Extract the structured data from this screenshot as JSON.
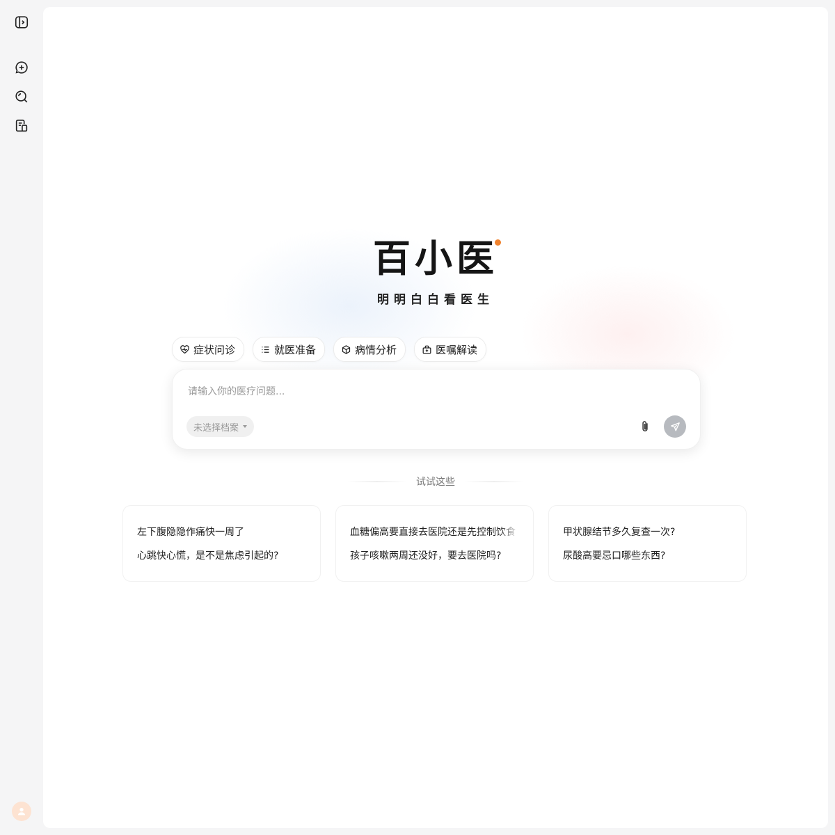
{
  "brand": {
    "logo": "百小医",
    "slogan": "明明白白看医生",
    "accent_color": "#f0822d"
  },
  "sidebar": {
    "items": [
      {
        "icon": "sidebar-toggle-icon"
      },
      {
        "icon": "new-chat-icon"
      },
      {
        "icon": "search-icon"
      },
      {
        "icon": "records-icon"
      }
    ],
    "avatar_icon": "user-icon"
  },
  "chips": [
    {
      "label": "症状问诊",
      "icon": "heart-pulse-icon"
    },
    {
      "label": "就医准备",
      "icon": "list-icon"
    },
    {
      "label": "病情分析",
      "icon": "cube-icon"
    },
    {
      "label": "医嘱解读",
      "icon": "medicine-box-icon"
    }
  ],
  "input": {
    "placeholder": "请输入你的医疗问题...",
    "profile_select": "未选择档案"
  },
  "suggestions": {
    "title": "试试这些",
    "cards": [
      {
        "q1": "左下腹隐隐作痛快一周了",
        "q2": "心跳快心慌，是不是焦虑引起的?"
      },
      {
        "q1": "血糖偏高要直接去医院还是先控制饮食",
        "q2": "孩子咳嗽两周还没好，要去医院吗?"
      },
      {
        "q1": "甲状腺结节多久复查一次?",
        "q2": "尿酸高要忌口哪些东西?"
      }
    ]
  }
}
